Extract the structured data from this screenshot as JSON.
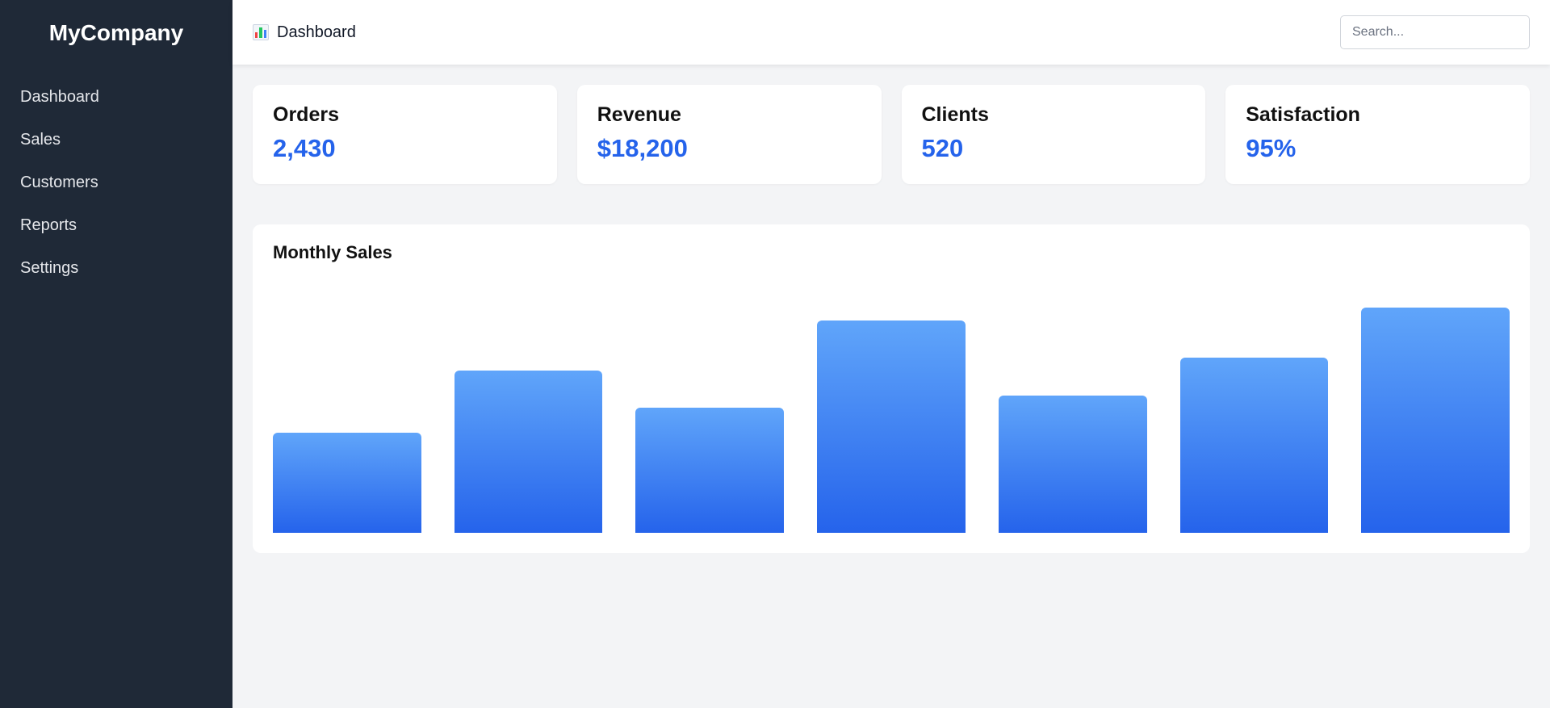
{
  "sidebar": {
    "brand": "MyCompany",
    "items": [
      {
        "label": "Dashboard"
      },
      {
        "label": "Sales"
      },
      {
        "label": "Customers"
      },
      {
        "label": "Reports"
      },
      {
        "label": "Settings"
      }
    ]
  },
  "header": {
    "icon": "bar-chart-icon",
    "title": "Dashboard",
    "search_placeholder": "Search...",
    "search_value": ""
  },
  "stats": [
    {
      "label": "Orders",
      "value": "2,430"
    },
    {
      "label": "Revenue",
      "value": "$18,200"
    },
    {
      "label": "Clients",
      "value": "520"
    },
    {
      "label": "Satisfaction",
      "value": "95%"
    }
  ],
  "colors": {
    "sidebar_bg": "#1f2937",
    "accent": "#2563eb",
    "bar_top": "#60a5fa",
    "bar_bottom": "#2563eb"
  },
  "chart_data": {
    "type": "bar",
    "title": "Monthly Sales",
    "categories": [],
    "values": [
      40,
      65,
      50,
      85,
      55,
      70,
      90
    ],
    "ylim": [
      0,
      100
    ],
    "grid": false,
    "xlabel": "",
    "ylabel": ""
  }
}
